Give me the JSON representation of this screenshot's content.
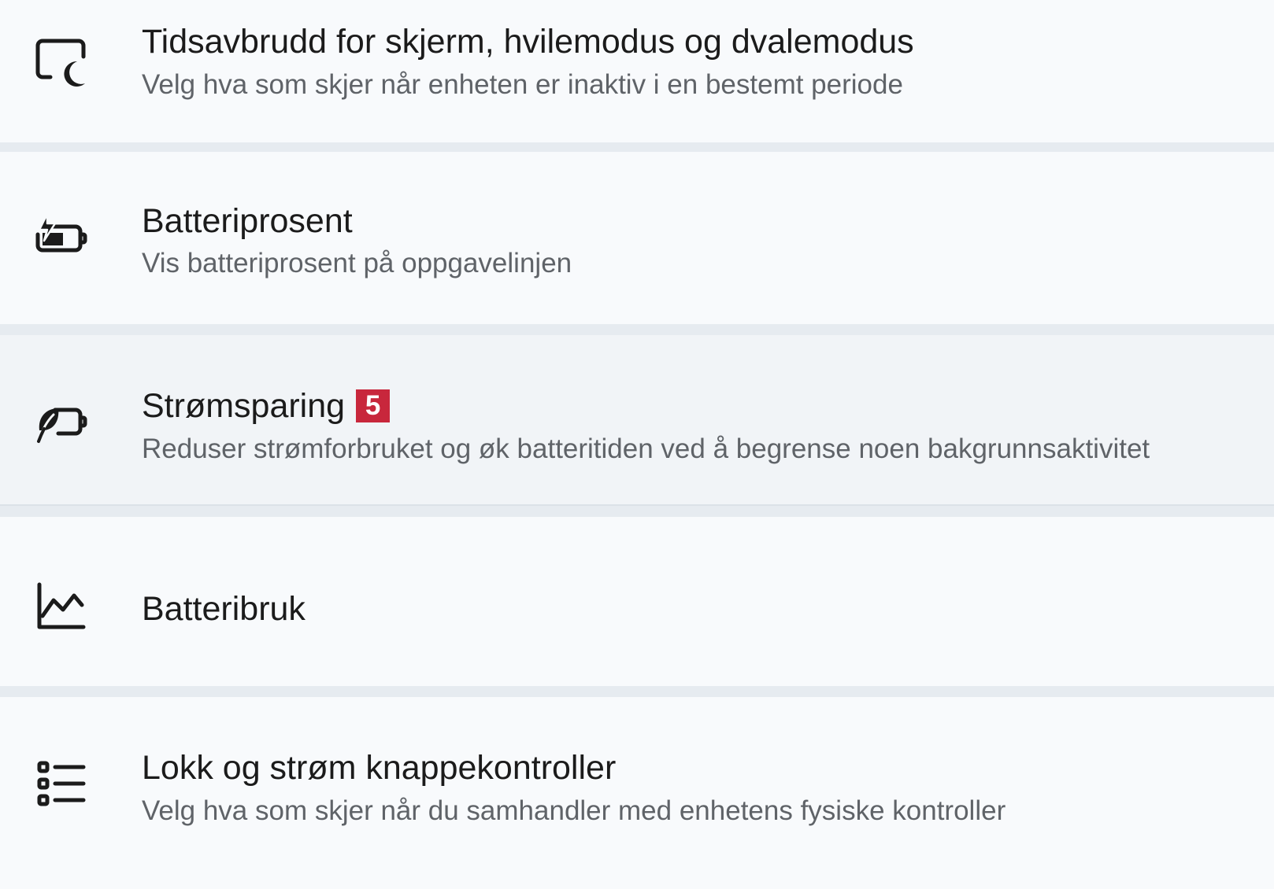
{
  "settings": {
    "items": [
      {
        "title": "Tidsavbrudd for skjerm, hvilemodus og dvalemodus",
        "subtitle": "Velg hva som skjer når enheten er inaktiv i en bestemt periode",
        "icon": "screen-sleep-icon"
      },
      {
        "title": "Batteriprosent",
        "subtitle": "Vis batteriprosent på oppgavelinjen",
        "icon": "battery-charging-icon"
      },
      {
        "title": "Strømsparing",
        "badge": "5",
        "subtitle": "Reduser strømforbruket og øk batteritiden ved å begrense noen bakgrunnsaktivitet",
        "icon": "battery-saver-icon"
      },
      {
        "title": "Batteribruk",
        "icon": "line-chart-icon"
      },
      {
        "title": "Lokk og strøm knappekontroller",
        "subtitle": "Velg hva som skjer når du samhandler med enhetens fysiske kontroller",
        "icon": "list-icon"
      }
    ]
  },
  "colors": {
    "badge": "#c8273c",
    "row_background": "#f8fafc",
    "row_highlight": "#f1f4f7",
    "separator": "#e6ebf0",
    "title_text": "#1b1b1b",
    "subtitle_text": "#5f6368"
  }
}
